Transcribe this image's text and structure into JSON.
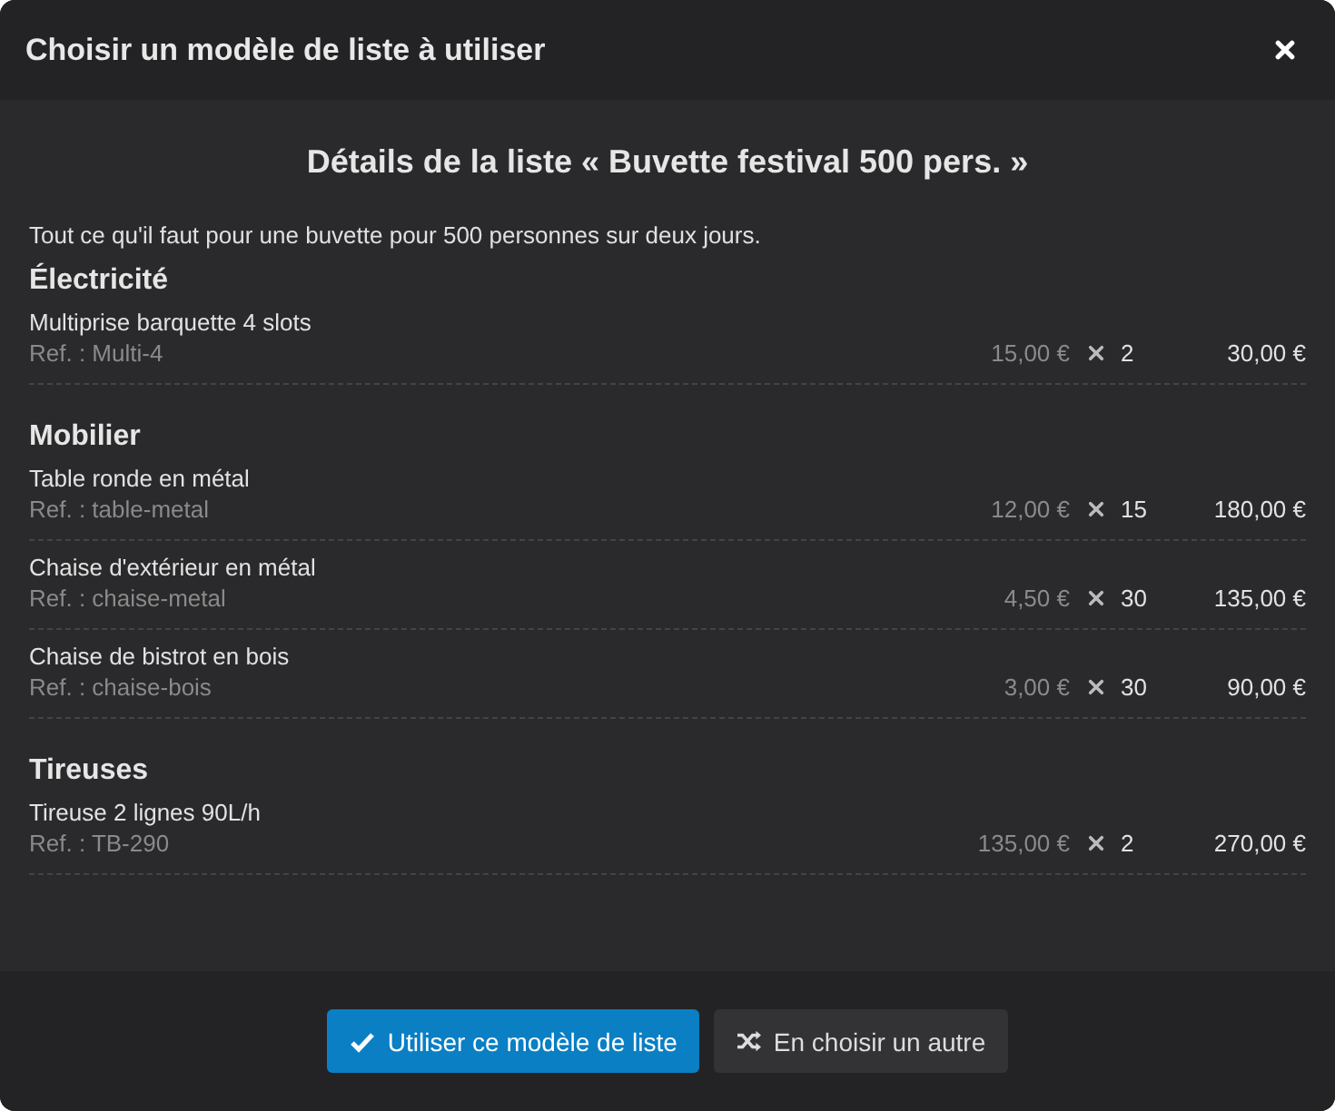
{
  "window": {
    "title": "Choisir un modèle de liste à utiliser"
  },
  "details": {
    "heading": "Détails de la liste « Buvette festival 500 pers. »",
    "description": "Tout ce qu'il faut pour une buvette pour 500 personnes sur deux jours."
  },
  "sections": [
    {
      "title": "Électricité",
      "items": [
        {
          "name": "Multiprise barquette 4 slots",
          "ref": "Ref. : Multi-4",
          "unit_price": "15,00 €",
          "quantity": "2",
          "total": "30,00 €"
        }
      ]
    },
    {
      "title": "Mobilier",
      "items": [
        {
          "name": "Table ronde en métal",
          "ref": "Ref. : table-metal",
          "unit_price": "12,00 €",
          "quantity": "15",
          "total": "180,00 €"
        },
        {
          "name": "Chaise d'extérieur en métal",
          "ref": "Ref. : chaise-metal",
          "unit_price": "4,50 €",
          "quantity": "30",
          "total": "135,00 €"
        },
        {
          "name": "Chaise de bistrot en bois",
          "ref": "Ref. : chaise-bois",
          "unit_price": "3,00 €",
          "quantity": "30",
          "total": "90,00 €"
        }
      ]
    },
    {
      "title": "Tireuses",
      "items": [
        {
          "name": "Tireuse 2 lignes 90L/h",
          "ref": "Ref. : TB-290",
          "unit_price": "135,00 €",
          "quantity": "2",
          "total": "270,00 €"
        }
      ]
    }
  ],
  "buttons": [
    {
      "kind": "primary",
      "label": "Utiliser ce modèle de liste"
    },
    {
      "kind": "secondary",
      "label": "En choisir un autre"
    }
  ]
}
